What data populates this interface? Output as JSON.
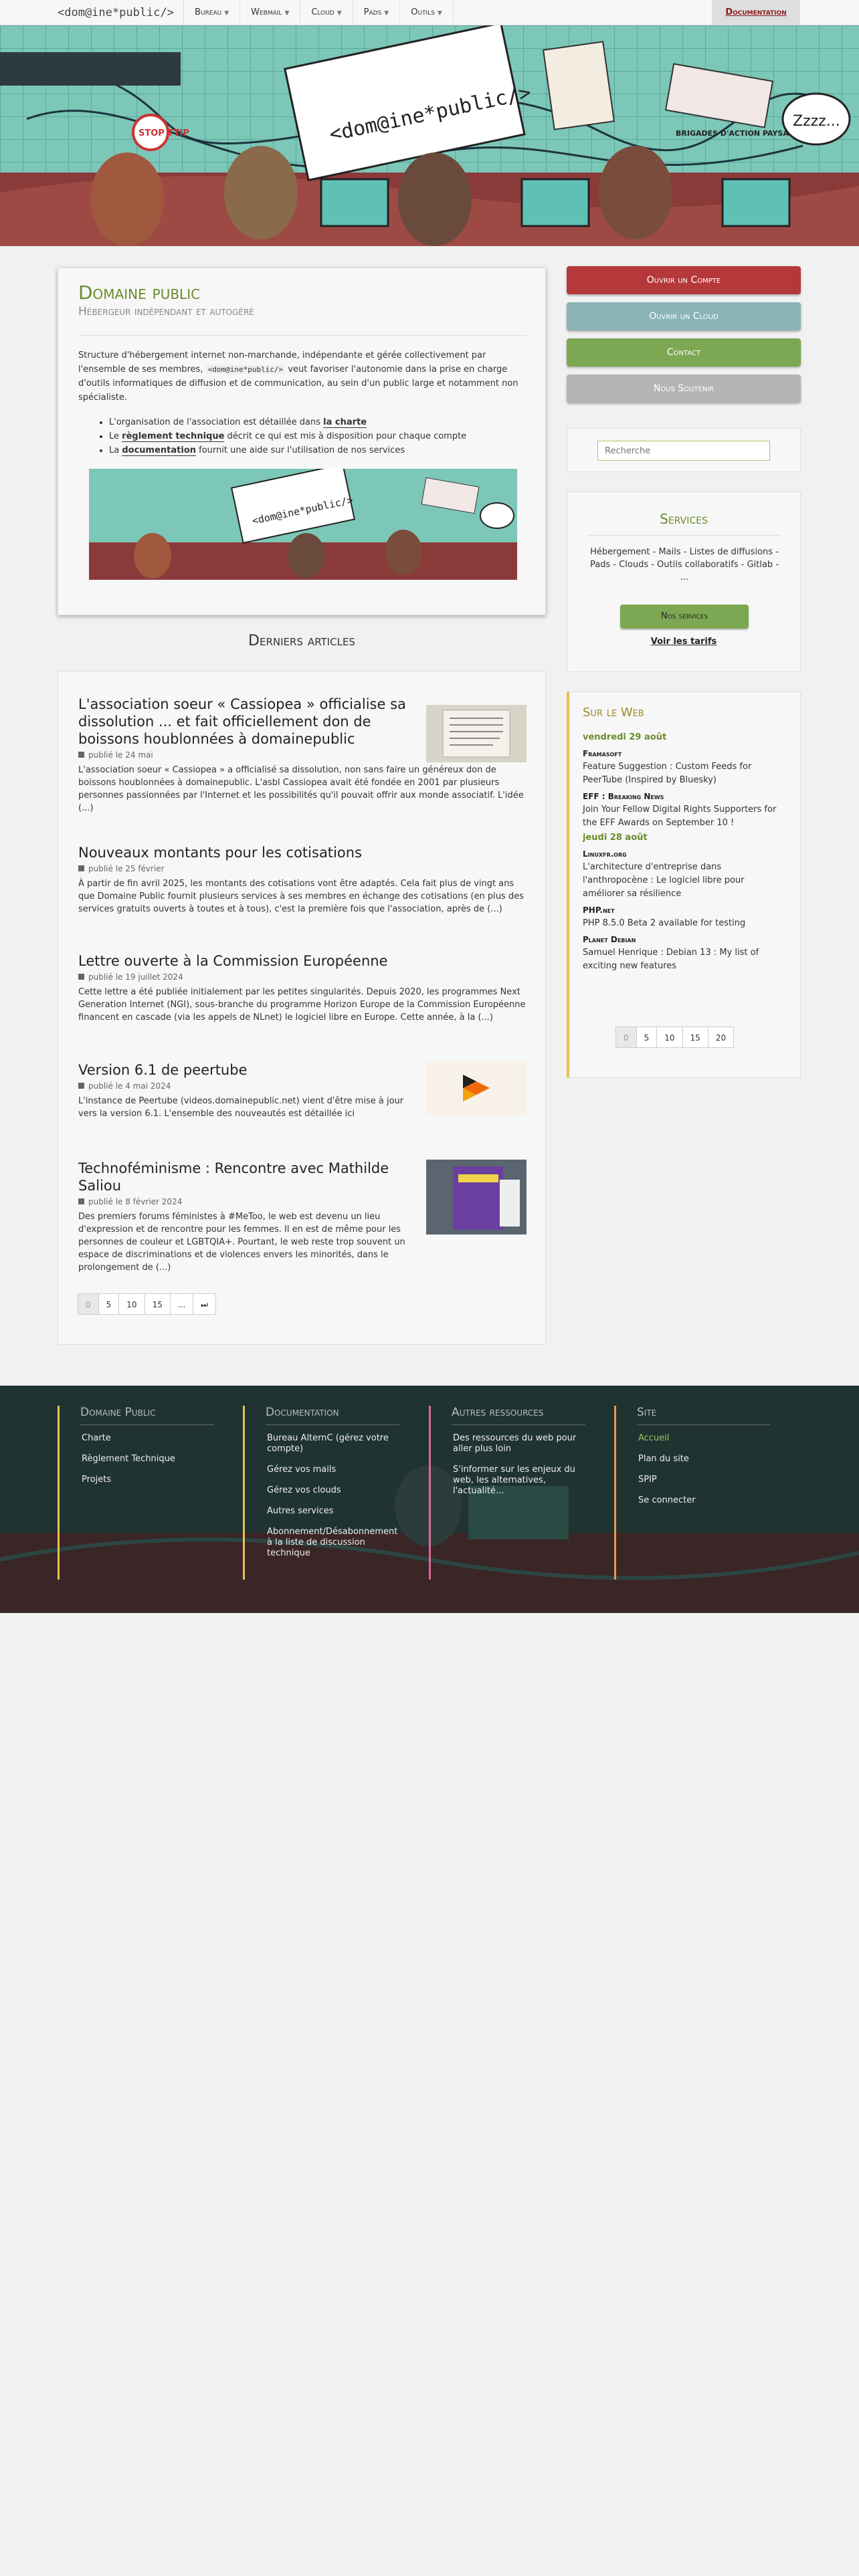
{
  "nav": {
    "logo": "<dom@ine*public/>",
    "items": [
      {
        "label": "Bureau"
      },
      {
        "label": "Webmail"
      },
      {
        "label": "Cloud"
      },
      {
        "label": "Pads"
      },
      {
        "label": "Outils"
      }
    ],
    "documentation": "Documentation"
  },
  "hero": {
    "sign": "<dom@ine*public/>",
    "stop": "STOP TTIP",
    "banner": "BRIGADES D'ACTION PAYSANNE",
    "zzz": "Zzzz..."
  },
  "intro": {
    "title": "Domaine public",
    "subtitle": "Hébergeur indépendant et autogéré",
    "text_1": "Structure d'hébergement internet non-marchande, indépendante et gérée collectivement par l'ensemble de ses membres,",
    "text_mono": "<dom@ine*public/>",
    "text_2": "veut favoriser l'autonomie dans la prise en charge d'outils informatiques de diffusion et de communication, au sein d'un public large et notamment non spécialiste.",
    "list": [
      {
        "pre": "L'organisation de l'association est détaillée dans ",
        "link": "la charte",
        "post": ""
      },
      {
        "pre": "Le ",
        "link": "règlement technique",
        "post": " décrit ce qui est mis à disposition pour chaque compte"
      },
      {
        "pre": "La ",
        "link": "documentation",
        "post": " fournit une aide sur l'utilisation de nos services"
      }
    ]
  },
  "articles": {
    "heading": "Derniers articles",
    "items": [
      {
        "title": "L'association soeur « Cassiopea » officialise sa dissolution ... et fait officiellement don de boissons houblonnées à domainepublic",
        "date": "publié le 24 mai",
        "excerpt": "L'association soeur « Cassiopea » a officialisé sa dissolution, non sans faire un généreux don de boissons houblonnées à domainepublic. L'asbl Cassiopea avait été fondée en 2001 par plusieurs personnes passionnées par l'Internet et les possibilités qu'il pouvait offrir aux monde associatif. L'idée (...)"
      },
      {
        "title": "Nouveaux montants pour les cotisations",
        "date": "publié le 25 février",
        "excerpt": "À partir de fin avril 2025, les montants des cotisations vont être adaptés. Cela fait plus de vingt ans que Domaine Public fournit plusieurs services à ses membres en échange des cotisations (en plus des services gratuits ouverts à toutes et à tous), c'est la première fois que l'association, après de (...)"
      },
      {
        "title": "Lettre ouverte à la Commission Européenne",
        "date": "publié le 19 juillet 2024",
        "excerpt": "Cette lettre a été publiée initialement par les petites singularités. Depuis 2020, les programmes Next Generation Internet (NGI), sous-branche du programme Horizon Europe de la Commission Européenne financent en cascade (via les appels de NLnet) le logiciel libre en Europe. Cette année, à la (...)"
      },
      {
        "title": "Version 6.1 de peertube",
        "date": "publié le 4 mai 2024",
        "excerpt": "L'instance de Peertube (videos.domainepublic.net) vient d'être mise à jour vers la version 6.1. L'ensemble des nouveautés est détaillée ici"
      },
      {
        "title": "Technoféminisme : Rencontre avec Mathilde Saliou",
        "date": "publié le 8 février 2024",
        "excerpt": "Des premiers forums féministes à #MeToo, le web est devenu un lieu d'expression et de rencontre pour les femmes. Il en est de même pour les personnes de couleur et LGBTQIA+. Pourtant, le web reste trop souvent un espace de discriminations et de violences envers les minorités, dans le prolongement de (...)"
      }
    ],
    "pager": [
      "0",
      "5",
      "10",
      "15",
      "...",
      "⏭"
    ]
  },
  "sidebar": {
    "buttons": [
      {
        "label": "Ouvrir un Compte",
        "color": "#b5393a"
      },
      {
        "label": "Ouvrir un Cloud",
        "color": "#8ab4b8"
      },
      {
        "label": "Contact",
        "color": "#7da853"
      },
      {
        "label": "Nous Soutenir",
        "color": "#b5b5b5"
      }
    ],
    "search_placeholder": "Recherche",
    "services": {
      "title": "Services",
      "text": "Hébergement - Mails - Listes de diffusions - Pads - Clouds - Outils collaboratifs - Gitlab - ...",
      "button": "Nos services",
      "link": "Voir les tarifs"
    },
    "web": {
      "title": "Sur le Web",
      "entries": [
        {
          "kind": "day",
          "text": "vendredi 29 août"
        },
        {
          "kind": "src",
          "text": "Framasoft"
        },
        {
          "kind": "it",
          "text": "Feature Suggestion : Custom Feeds for PeerTube (Inspired by Bluesky)"
        },
        {
          "kind": "src",
          "text": "EFF : Breaking News"
        },
        {
          "kind": "it",
          "text": "Join Your Fellow Digital Rights Supporters for the EFF Awards on September 10 !"
        },
        {
          "kind": "day",
          "text": "jeudi 28 août"
        },
        {
          "kind": "src",
          "text": "Linuxfr.org"
        },
        {
          "kind": "it",
          "text": "L'architecture d'entreprise dans l'anthropocène : Le logiciel libre pour améliorer sa résilience"
        },
        {
          "kind": "src",
          "text": "PHP.net"
        },
        {
          "kind": "it",
          "text": "PHP 8.5.0 Beta 2 available for testing"
        },
        {
          "kind": "src",
          "text": "Planet Debian"
        },
        {
          "kind": "it",
          "text": "Samuel Henrique : Debian 13 : My list of exciting new features"
        }
      ],
      "pager": [
        "0",
        "5",
        "10",
        "15",
        "20"
      ]
    }
  },
  "footer": {
    "columns": [
      {
        "title": "Domaine Public",
        "color": "#e3c44c",
        "items": [
          "Charte",
          "Règlement Technique",
          "Projets"
        ]
      },
      {
        "title": "Documentation",
        "color": "#e3c44c",
        "items": [
          "Bureau AlternC (gérez votre compte)",
          "Gérez vos mails",
          "Gérez vos clouds",
          "Autres services",
          "Abonnement/Désabonnement à la liste de discussion technique"
        ]
      },
      {
        "title": "Autres ressources",
        "color": "#d9699b",
        "items": [
          "Des ressources du web pour aller plus loin",
          "S'informer sur les enjeux du web, les alternatives, l'actualité..."
        ]
      },
      {
        "title": "Site",
        "color": "#e89a4a",
        "items": [
          "Accueil",
          "Plan du site",
          "SPIP",
          "Se connecter"
        ]
      }
    ]
  }
}
